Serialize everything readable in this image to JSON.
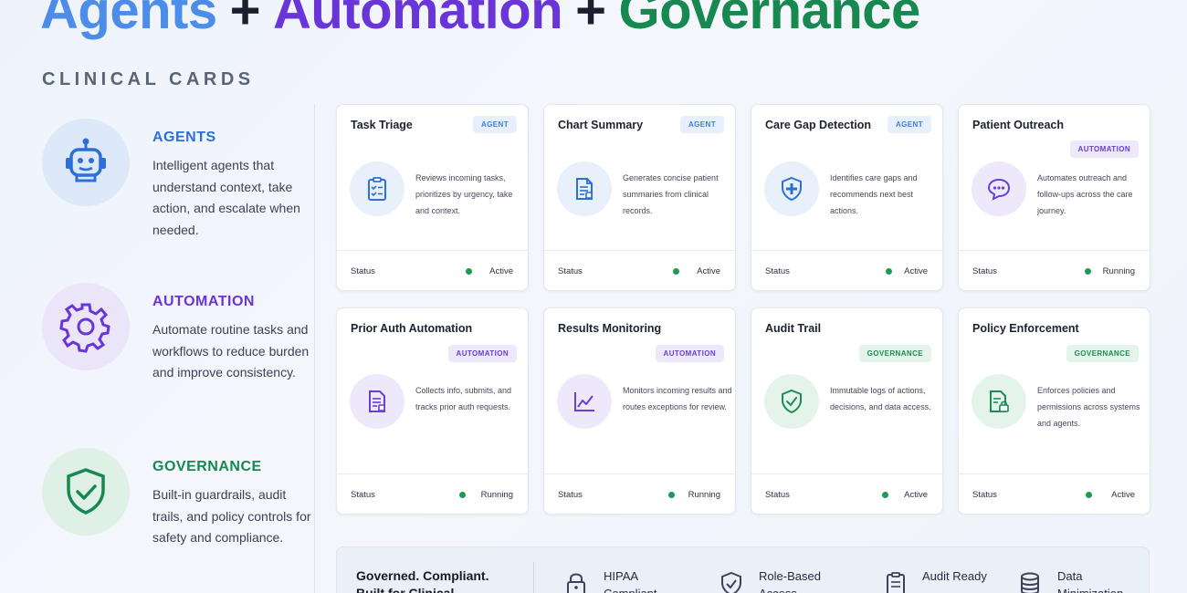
{
  "hero": {
    "part1": "Agents",
    "plus1": "+",
    "part2": "Automation",
    "plus2": "+",
    "part3": "Governance"
  },
  "section_label": "CLINICAL CARDS",
  "categories": [
    {
      "title": "AGENTS",
      "desc": "Intelligent agents that understand context, take action, and escalate when needed.",
      "icon": "robot-icon",
      "color": "#2d6fd6"
    },
    {
      "title": "AUTOMATION",
      "desc": "Automate routine tasks and workflows to reduce burden and improve consistency.",
      "icon": "gear-icon",
      "color": "#6a35d8"
    },
    {
      "title": "GOVERNANCE",
      "desc": "Built-in guardrails, audit trails, and policy controls for safety and compliance.",
      "icon": "shield-check-icon",
      "color": "#17884f"
    }
  ],
  "cards": [
    {
      "title": "Task Triage",
      "badge": "AGENT",
      "desc": "Reviews incoming tasks, prioritizes by urgency, take and context.",
      "status_label": "Status",
      "status": "Active",
      "icon": "clipboard-check-icon"
    },
    {
      "title": "Chart Summary",
      "badge": "AGENT",
      "desc": "Generates concise patient summaries from clinical records.",
      "status_label": "Status",
      "status": "Active",
      "icon": "document-icon"
    },
    {
      "title": "Care Gap Detection",
      "badge": "AGENT",
      "desc": "Identifies care gaps and recommends next best actions.",
      "status_label": "Status",
      "status": "Active",
      "icon": "shield-plus-icon"
    },
    {
      "title": "Patient Outreach",
      "badge": "AUTOMATION",
      "desc": "Automates outreach and follow-ups across the care journey.",
      "status_label": "Status",
      "status": "Running",
      "icon": "chat-icon"
    },
    {
      "title": "Prior Auth Automation",
      "badge": "AUTOMATION",
      "desc": "Collects info, submits, and tracks prior auth requests.",
      "status_label": "Status",
      "status": "Running",
      "icon": "document-icon"
    },
    {
      "title": "Results Monitoring",
      "badge": "AUTOMATION",
      "desc": "Monitors incoming results and routes exceptions for review.",
      "status_label": "Status",
      "status": "Running",
      "icon": "trend-chart-icon"
    },
    {
      "title": "Audit Trail",
      "badge": "GOVERNANCE",
      "desc": "Immutable logs of actions, decisions, and data access.",
      "status_label": "Status",
      "status": "Active",
      "icon": "shield-check-icon"
    },
    {
      "title": "Policy Enforcement",
      "badge": "GOVERNANCE",
      "desc": "Enforces policies and permissions across systems and agents.",
      "status_label": "Status",
      "status": "Active",
      "icon": "document-lock-icon"
    }
  ],
  "bottom": {
    "title": "Governed. Compliant. Built for Clinical",
    "features": [
      {
        "label": "HIPAA Compliant",
        "icon": "lock-icon"
      },
      {
        "label": "Role-Based Access",
        "icon": "shield-check-icon"
      },
      {
        "label": "Audit Ready",
        "icon": "clipboard-icon"
      },
      {
        "label": "Data Minimization",
        "icon": "database-icon"
      }
    ]
  },
  "colors": {
    "agent": "#3f7fd9",
    "automation": "#6a3ed6",
    "governance": "#1f8a52",
    "status_dot": "#1e9a55"
  }
}
